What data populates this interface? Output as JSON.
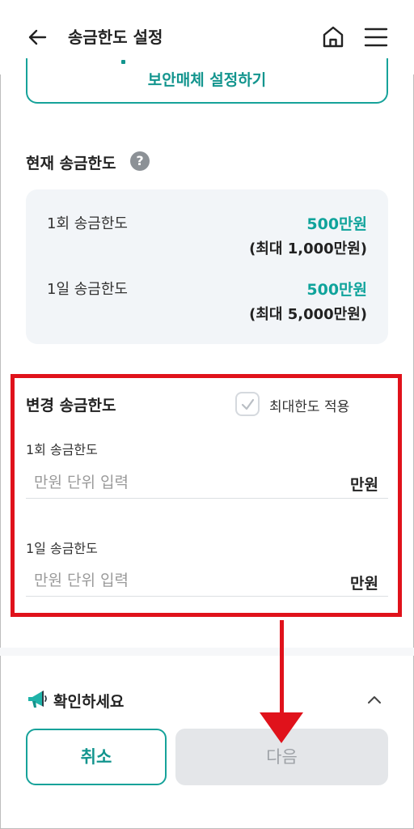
{
  "header": {
    "title": "송금한도 설정"
  },
  "security_button": {
    "label": "보안매체 설정하기"
  },
  "current_limits": {
    "title": "현재 송금한도",
    "help_symbol": "?",
    "rows": [
      {
        "label": "1회 송금한도",
        "value": "500만원",
        "max": "(최대 1,000만원)"
      },
      {
        "label": "1일 송금한도",
        "value": "500만원",
        "max": "(최대 5,000만원)"
      }
    ]
  },
  "change_limits": {
    "title": "변경 송금한도",
    "max_apply_label": "최대한도 적용",
    "max_apply_checked": false,
    "fields": [
      {
        "label": "1회 송금한도",
        "placeholder": "만원 단위 입력",
        "value": "",
        "unit": "만원"
      },
      {
        "label": "1일 송금한도",
        "placeholder": "만원 단위 입력",
        "value": "",
        "unit": "만원"
      }
    ]
  },
  "notice": {
    "label": "확인하세요",
    "expanded": false
  },
  "footer": {
    "cancel_label": "취소",
    "next_label": "다음",
    "next_enabled": false
  },
  "colors": {
    "accent": "#13958e",
    "annotation": "#e0121b",
    "disabled_button": "#e4e6e9",
    "card_background": "#f2f5f8"
  },
  "icons": [
    "back-arrow-icon",
    "home-icon",
    "hamburger-menu-icon",
    "help-icon",
    "checkmark-icon",
    "megaphone-icon",
    "chevron-up-icon"
  ]
}
